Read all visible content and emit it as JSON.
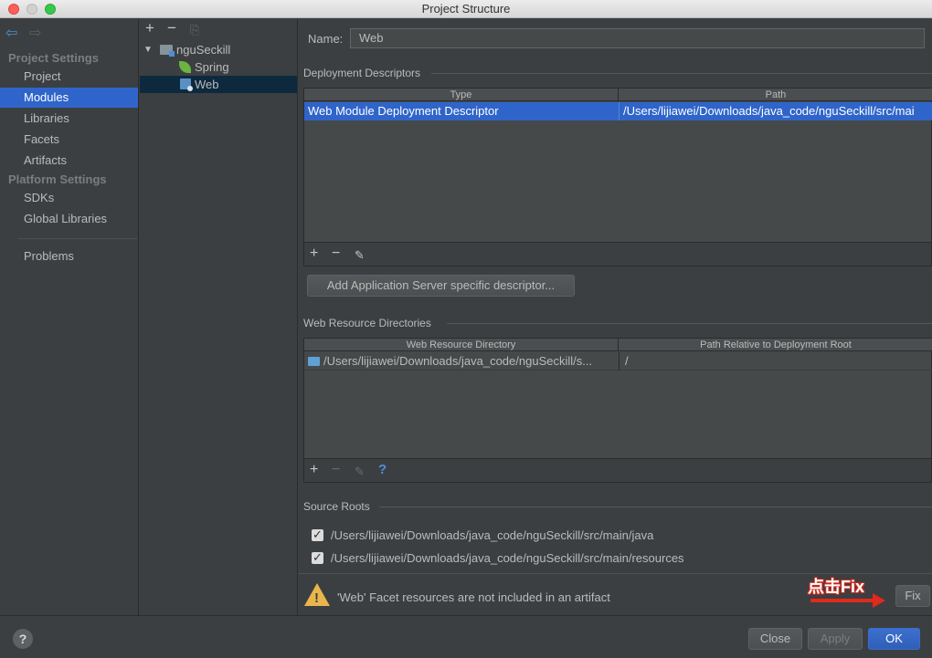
{
  "window": {
    "title": "Project Structure"
  },
  "sidebar": {
    "project_settings_header": "Project Settings",
    "platform_settings_header": "Platform Settings",
    "items": [
      {
        "label": "Project"
      },
      {
        "label": "Modules"
      },
      {
        "label": "Libraries"
      },
      {
        "label": "Facets"
      },
      {
        "label": "Artifacts"
      },
      {
        "label": "SDKs"
      },
      {
        "label": "Global Libraries"
      },
      {
        "label": "Problems"
      }
    ],
    "selected": "Modules"
  },
  "tree": {
    "toolbar": {
      "add": "+",
      "remove": "−",
      "copy": "⎘"
    },
    "root": "nguSeckill",
    "children": [
      {
        "label": "Spring"
      },
      {
        "label": "Web"
      }
    ],
    "selected": "Web"
  },
  "main": {
    "name_label": "Name:",
    "name_value": "Web",
    "deployment": {
      "title": "Deployment Descriptors",
      "columns": [
        "Type",
        "Path"
      ],
      "rows": [
        {
          "type": "Web Module Deployment Descriptor",
          "path": "/Users/lijiawei/Downloads/java_code/nguSeckill/src/mai"
        }
      ],
      "add_server_button": "Add Application Server specific descriptor..."
    },
    "web_resources": {
      "title": "Web Resource Directories",
      "columns": [
        "Web Resource Directory",
        "Path Relative to Deployment Root"
      ],
      "rows": [
        {
          "dir": "/Users/lijiawei/Downloads/java_code/nguSeckill/s...",
          "rel": "/"
        }
      ],
      "help": "?"
    },
    "source_roots": {
      "title": "Source Roots",
      "items": [
        {
          "path": "/Users/lijiawei/Downloads/java_code/nguSeckill/src/main/java",
          "checked": true
        },
        {
          "path": "/Users/lijiawei/Downloads/java_code/nguSeckill/src/main/resources",
          "checked": true
        }
      ]
    },
    "warning": {
      "text": "'Web' Facet resources are not included in an artifact",
      "fix_button": "Fix",
      "annotation": "点击Fix"
    }
  },
  "footer": {
    "help": "?",
    "close": "Close",
    "apply": "Apply",
    "ok": "OK"
  },
  "colors": {
    "selection": "#2f65ca",
    "background": "#3c3f41",
    "warning": "#e8b64c",
    "annotation": "#e02a1c"
  }
}
